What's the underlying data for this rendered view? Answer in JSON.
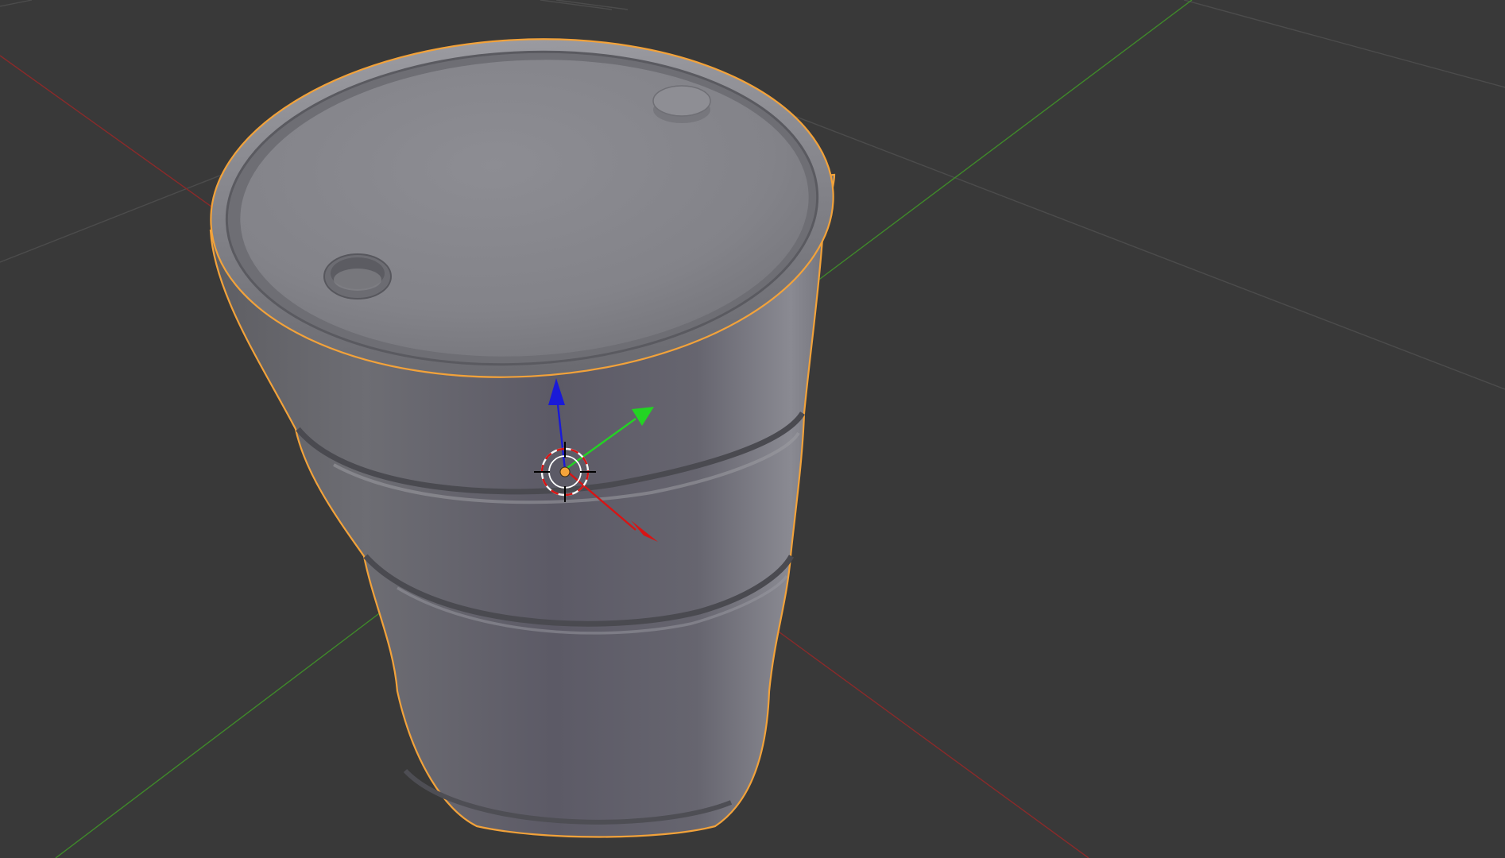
{
  "viewport": {
    "background": "#393939",
    "grid_color": "#4b4b4b",
    "x_axis_color": "#8a2a2a",
    "y_axis_color": "#3f8a2a",
    "selection_outline_color": "#f2a23a",
    "barrel_color": "#7f7f86"
  },
  "object": {
    "kind": "oil-barrel",
    "selected": true
  },
  "gizmo": {
    "type": "translate-manipulator",
    "x_color": "#d81414",
    "y_color": "#23d423",
    "z_color": "#1a1ad8",
    "origin_color": "#f5a43a",
    "cursor_icon": "3d-cursor-icon"
  }
}
